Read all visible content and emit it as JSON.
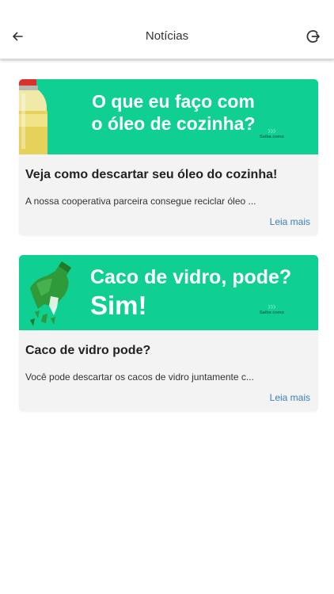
{
  "header": {
    "title": "Notícias",
    "back_icon": "arrow-left-icon",
    "logout_icon": "logout-icon"
  },
  "colors": {
    "banner_green": "#0fcf93",
    "link_blue": "#3a7fb8",
    "card_bg": "#f3f3f4"
  },
  "news": [
    {
      "banner_text_line1": "O que eu faço com",
      "banner_text_line2": "o óleo de cozinha?",
      "banner_brand": "Saiba como",
      "banner_icon": "oil-bottle-icon",
      "title": "Veja como descartar seu óleo do cozinha!",
      "summary": "A nossa cooperativa parceira consegue reciclar óleo ...",
      "read_more": "Leia mais"
    },
    {
      "banner_text_line1": "Caco de vidro, pode?",
      "banner_text_line2": "Sim!",
      "banner_brand": "Saiba como",
      "banner_icon": "broken-glass-bottle-icon",
      "title": "Caco de vidro pode?",
      "summary": "Você pode descartar os cacos de vidro juntamente c...",
      "read_more": "Leia mais"
    }
  ]
}
